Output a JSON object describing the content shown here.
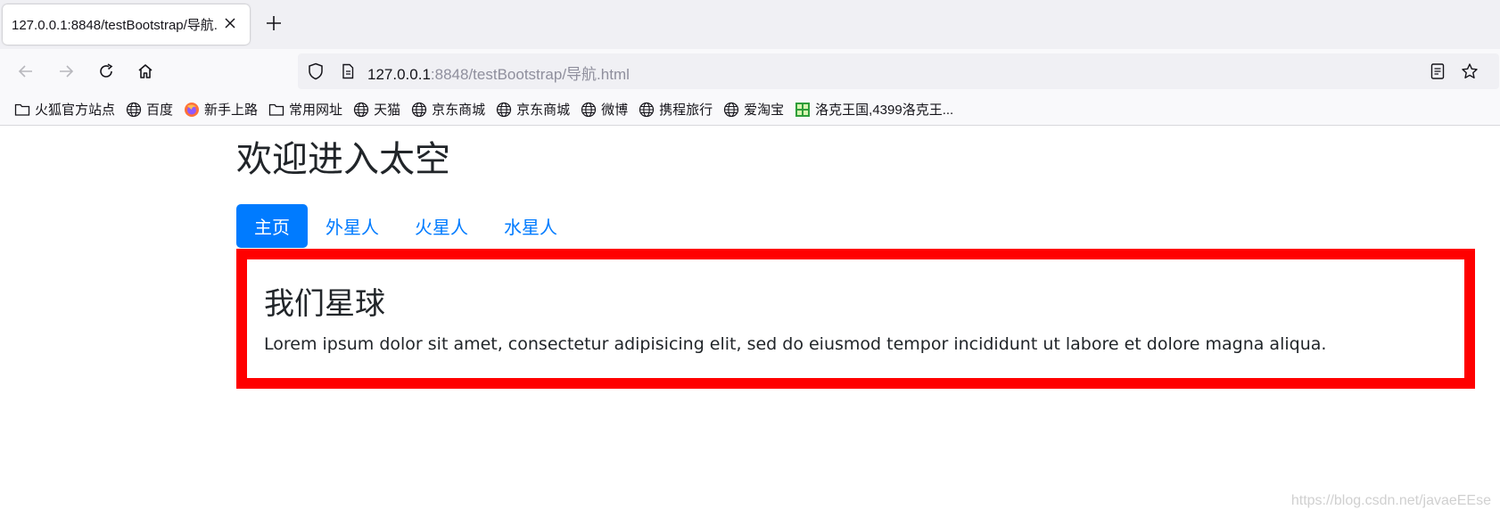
{
  "tab": {
    "title": "127.0.0.1:8848/testBootstrap/导航.",
    "close_icon": "close-icon"
  },
  "new_tab_icon": "plus-icon",
  "nav": {
    "back_icon": "arrow-left-icon",
    "forward_icon": "arrow-right-icon",
    "reload_icon": "reload-icon",
    "home_icon": "home-icon"
  },
  "url": {
    "host": "127.0.0.1",
    "rest": ":8848/testBootstrap/导航.html",
    "shield_icon": "shield-icon",
    "page_icon": "page-icon",
    "reader_icon": "reader-view-icon",
    "star_icon": "star-icon"
  },
  "bookmarks": [
    {
      "label": "火狐官方站点",
      "icon": "folder-icon"
    },
    {
      "label": "百度",
      "icon": "globe-icon"
    },
    {
      "label": "新手上路",
      "icon": "firefox-icon"
    },
    {
      "label": "常用网址",
      "icon": "folder-icon"
    },
    {
      "label": "天猫",
      "icon": "globe-icon"
    },
    {
      "label": "京东商城",
      "icon": "globe-icon"
    },
    {
      "label": "京东商城",
      "icon": "globe-icon"
    },
    {
      "label": "微博",
      "icon": "globe-icon"
    },
    {
      "label": "携程旅行",
      "icon": "globe-icon"
    },
    {
      "label": "爱淘宝",
      "icon": "globe-icon"
    },
    {
      "label": "洛克王国,4399洛克王...",
      "icon": "game-icon"
    }
  ],
  "page": {
    "title": "欢迎进入太空",
    "pills": [
      {
        "label": "主页",
        "active": true
      },
      {
        "label": "外星人",
        "active": false
      },
      {
        "label": "火星人",
        "active": false
      },
      {
        "label": "水星人",
        "active": false
      }
    ],
    "panel": {
      "title": "我们星球",
      "text": "Lorem ipsum dolor sit amet, consectetur adipisicing elit, sed do eiusmod tempor incididunt ut labore et dolore magna aliqua."
    },
    "watermark": "https://blog.csdn.net/javaeEEse"
  },
  "colors": {
    "accent": "#007bff",
    "panel_border": "#ff0000",
    "text": "#212529"
  }
}
